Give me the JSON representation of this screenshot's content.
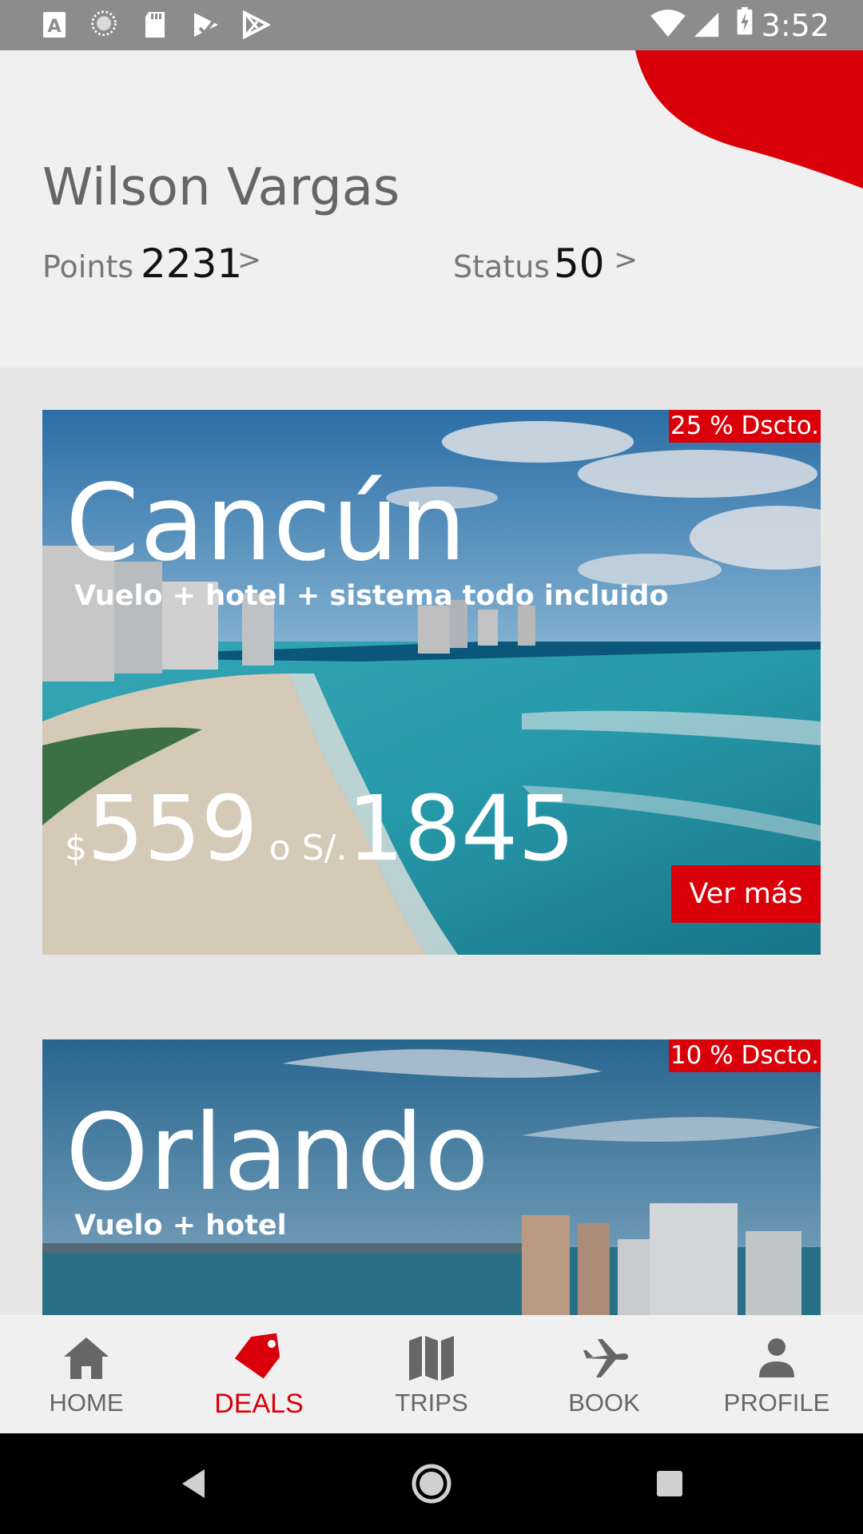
{
  "status_bar": {
    "time": "3:52",
    "icons": [
      "font-a-icon",
      "loading-circle-icon",
      "sd-card-icon",
      "play-store-icon",
      "play-store-outline-icon",
      "wifi-icon",
      "signal-icon",
      "battery-charging-icon"
    ]
  },
  "header": {
    "user_name": "Wilson Vargas",
    "points_label": "Points",
    "points_value": "2231",
    "status_label": "Status",
    "status_value": "50",
    "chevron": ">",
    "accent_color": "#d9000a"
  },
  "deals": [
    {
      "discount": "25 % Dscto.",
      "destination": "Cancún",
      "subtitle": "Vuelo + hotel + sistema todo incluido",
      "price_currency": "$",
      "price_usd": "559",
      "price_or": "o S/.",
      "price_pen": "1845",
      "cta": "Ver más"
    },
    {
      "discount": "10 % Dscto.",
      "destination": "Orlando",
      "subtitle": "Vuelo + hotel"
    }
  ],
  "bottom_nav": {
    "active": "DEALS",
    "items": [
      {
        "label": "HOME",
        "icon": "home-icon"
      },
      {
        "label": "DEALS",
        "icon": "tag-icon"
      },
      {
        "label": "TRIPS",
        "icon": "map-icon"
      },
      {
        "label": "BOOK",
        "icon": "airplane-icon"
      },
      {
        "label": "PROFILE",
        "icon": "person-icon"
      }
    ]
  },
  "system_nav": [
    "back-icon",
    "home-circle-icon",
    "recents-icon"
  ],
  "colors": {
    "brand_red": "#d9000a",
    "inactive_nav": "#666666",
    "status_bar": "#8c8c8c"
  }
}
